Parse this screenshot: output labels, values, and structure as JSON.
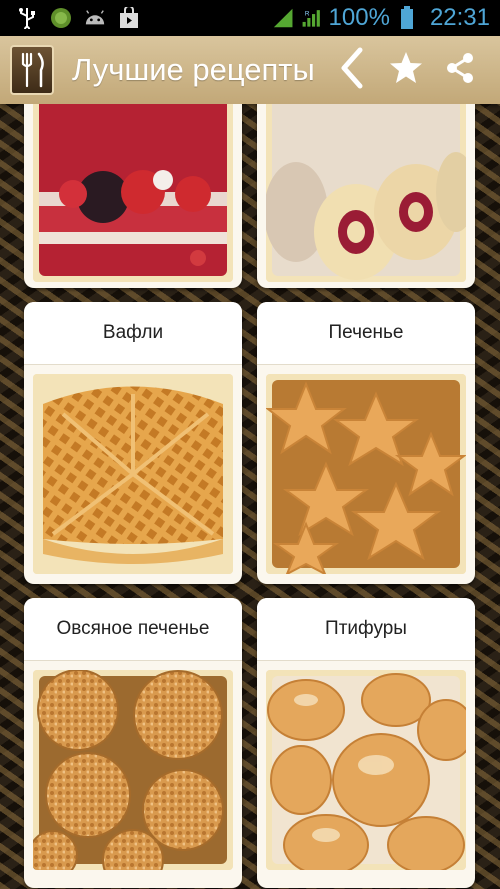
{
  "status_bar": {
    "battery_percent": "100%",
    "time": "22:31",
    "icons": [
      "usb-icon",
      "app-notification-icon",
      "android-icon",
      "store-icon",
      "wifi-icon",
      "signal-icon",
      "battery-icon"
    ]
  },
  "action_bar": {
    "title": "Лучшие рецепты",
    "icons": [
      "fork-knife-icon",
      "back-icon",
      "star-icon",
      "share-icon"
    ]
  },
  "cards": [
    {
      "label": "",
      "image": "berry-cake"
    },
    {
      "label": "",
      "image": "swiss-roll"
    },
    {
      "label": "Вафли",
      "image": "waffles"
    },
    {
      "label": "Печенье",
      "image": "star-cookies"
    },
    {
      "label": "Овсяное печенье",
      "image": "oat-cookies"
    },
    {
      "label": "Птифуры",
      "image": "petit-fours"
    }
  ],
  "colors": {
    "accent": "#4fa6d6",
    "action_bar": "#c9b084",
    "card": "#fbf7ee"
  }
}
